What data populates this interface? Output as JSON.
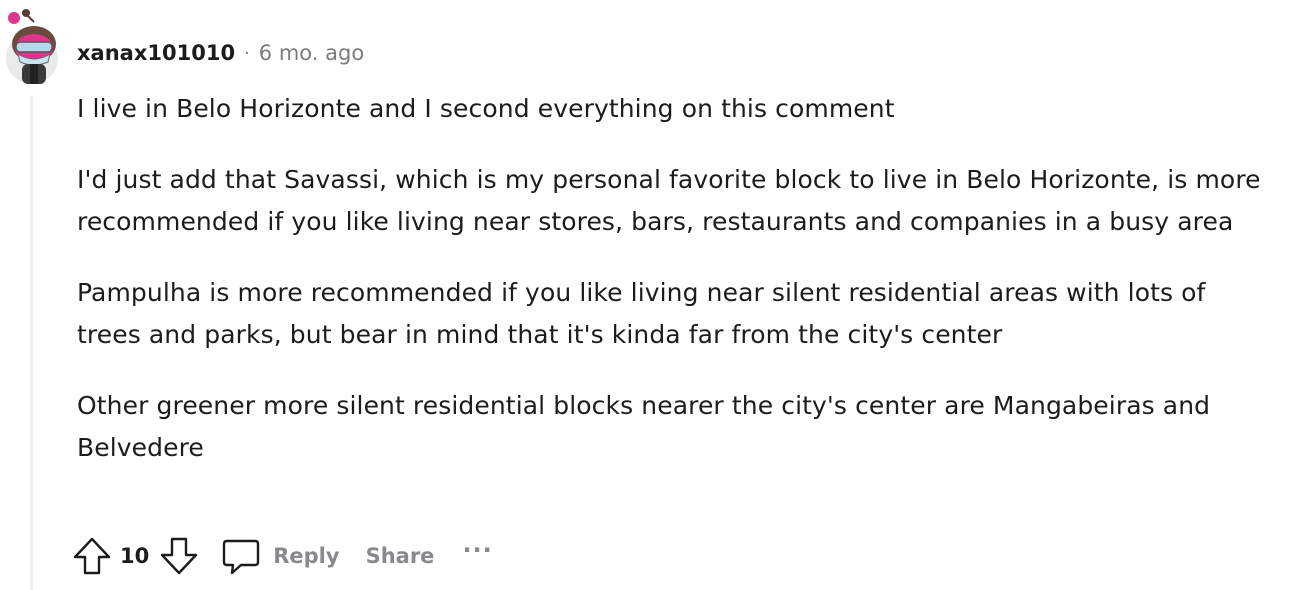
{
  "comment": {
    "username": "xanax101010",
    "separator": "·",
    "age": "6 mo. ago",
    "paragraphs": [
      "I live in Belo Horizonte and I second everything on this comment",
      "I'd just add that Savassi, which is my personal favorite block to live in Belo Horizonte, is more recommended if you like living near stores, bars, restaurants and companies in a busy area",
      "Pampulha is more recommended if you like living near silent residential areas with lots of trees and parks, but bear in mind that it's kinda far from the city's center",
      "Other greener more silent residential blocks nearer the city's center are Mangabeiras and Belvedere"
    ],
    "score": "10",
    "reply_label": "Reply",
    "share_label": "Share",
    "more_label": "···"
  },
  "icons": {
    "avatar": "snoo-avatar",
    "upvote": "arrow-up-icon",
    "downvote": "arrow-down-icon",
    "reply": "speech-bubble-icon",
    "more": "ellipsis-icon"
  },
  "colors": {
    "text": "#1c1c1c",
    "muted": "#7c7c7c",
    "action": "#878a8c",
    "thread_line": "#edeff1",
    "avatar_accent": "#e0358f"
  }
}
